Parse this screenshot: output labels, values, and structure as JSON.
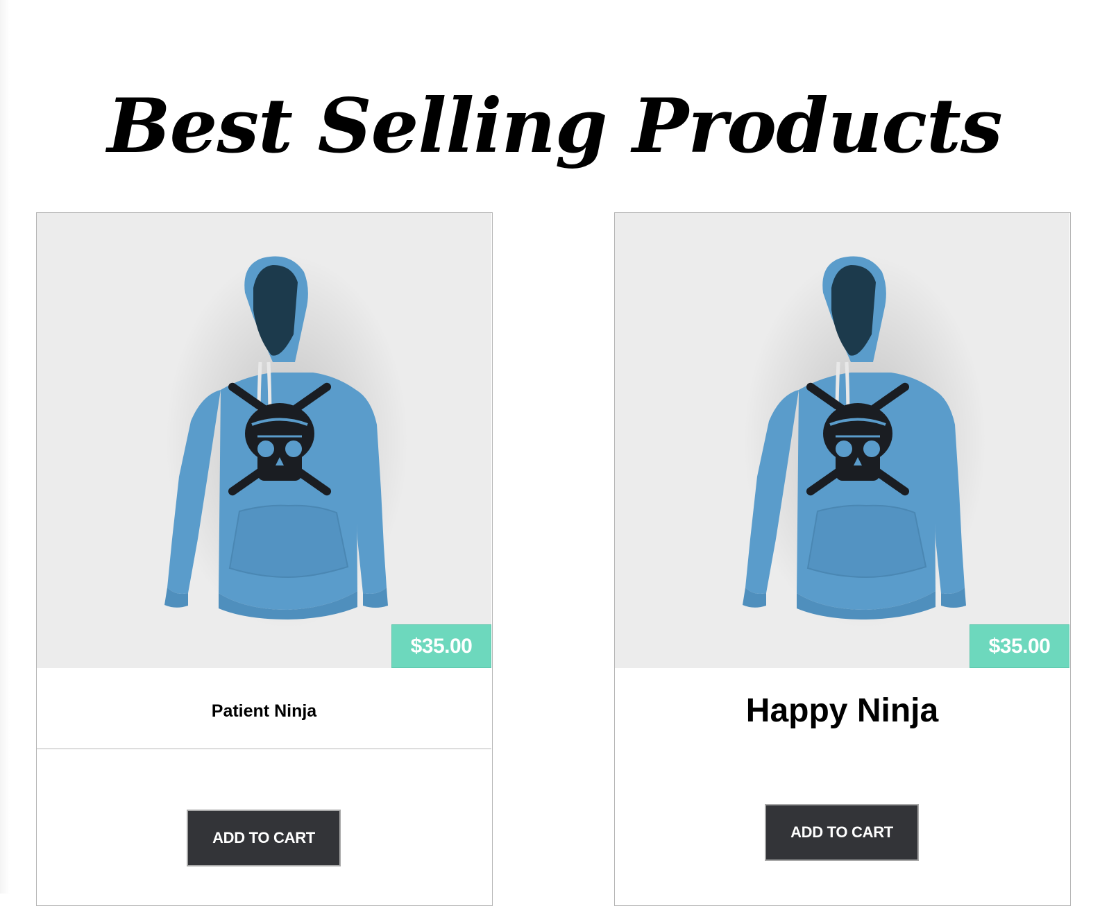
{
  "page": {
    "title": "Best Selling Products"
  },
  "products": [
    {
      "name": "Patient Ninja",
      "price": "$35.00",
      "button_label": "ADD TO CART",
      "image_icon": "hoodie-image"
    },
    {
      "name": "Happy Ninja",
      "price": "$35.00",
      "button_label": "ADD TO CART",
      "image_icon": "hoodie-image"
    }
  ],
  "colors": {
    "price_badge": "#6dd8bd",
    "button": "#333438",
    "image_background": "#ececec",
    "hoodie": "#5a9ccb"
  }
}
